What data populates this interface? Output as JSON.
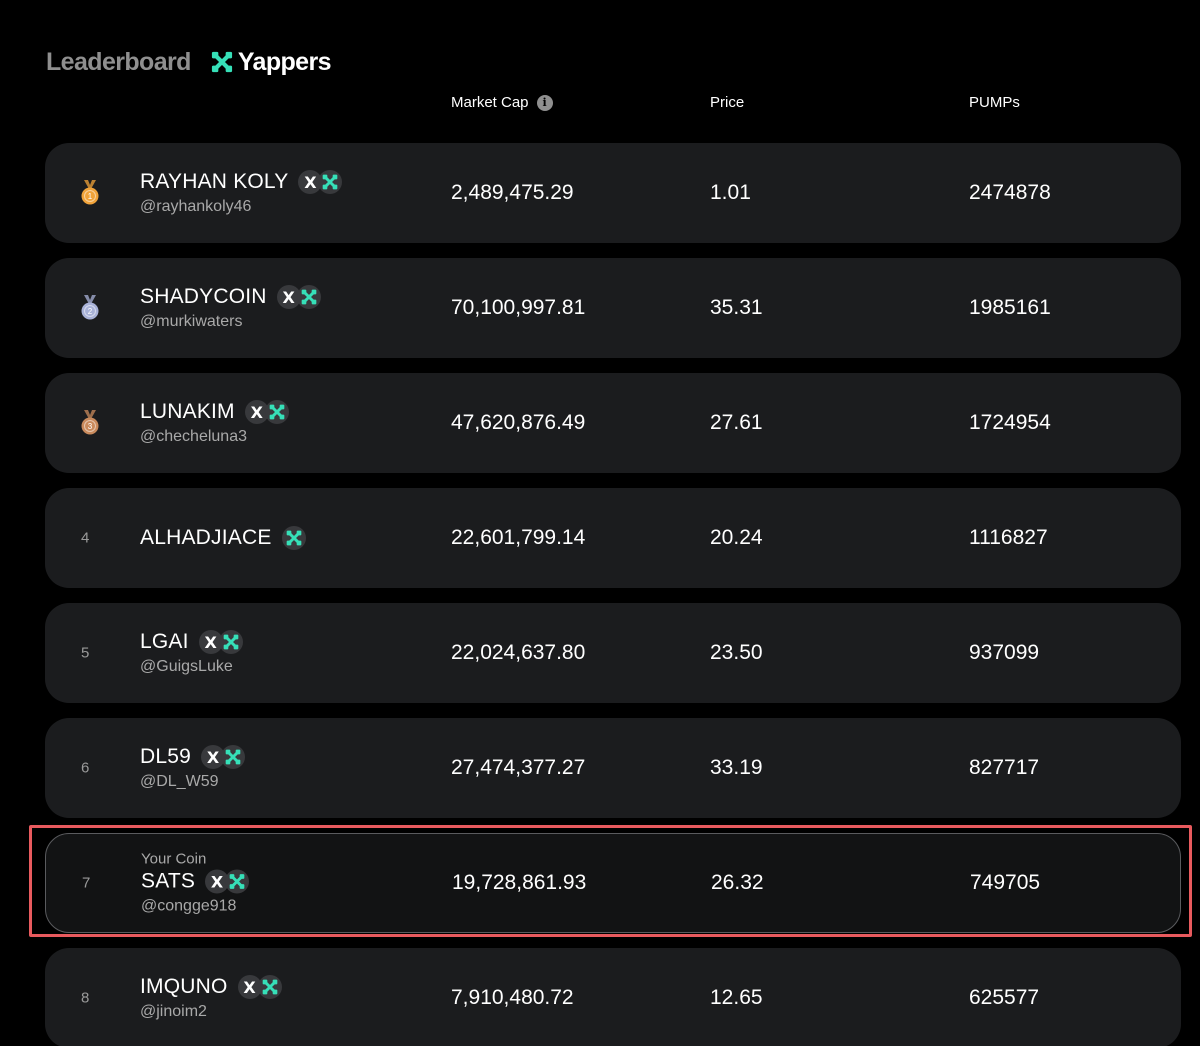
{
  "header": {
    "tab_leaderboard": "Leaderboard",
    "tab_yappers": "Yappers"
  },
  "columns": {
    "market_cap": "Market Cap",
    "price": "Price",
    "pumps": "PUMPs"
  },
  "colors": {
    "accent": "#36e0b8",
    "highlight_border": "#e85a5e",
    "row_bg": "#1b1c1e",
    "gold": "#f1a33a",
    "silver": "#a9b2d8",
    "bronze": "#c98a5c"
  },
  "rows": [
    {
      "rank": "1",
      "medal": "gold",
      "name": "RAYHAN KOLY",
      "handle": "@rayhankoly46",
      "badges": [
        "x-icon",
        "yappers-icon"
      ],
      "market_cap": "2,489,475.29",
      "price": "1.01",
      "pumps": "2474878"
    },
    {
      "rank": "2",
      "medal": "silver",
      "name": "SHADYCOIN",
      "handle": "@murkiwaters",
      "badges": [
        "x-icon",
        "yappers-icon"
      ],
      "market_cap": "70,100,997.81",
      "price": "35.31",
      "pumps": "1985161"
    },
    {
      "rank": "3",
      "medal": "bronze",
      "name": "LUNAKIM",
      "handle": "@checheluna3",
      "badges": [
        "x-icon",
        "yappers-icon"
      ],
      "market_cap": "47,620,876.49",
      "price": "27.61",
      "pumps": "1724954"
    },
    {
      "rank": "4",
      "name": "ALHADJIACE",
      "handle": "",
      "badges": [
        "yappers-icon"
      ],
      "market_cap": "22,601,799.14",
      "price": "20.24",
      "pumps": "1116827"
    },
    {
      "rank": "5",
      "name": "LGAI",
      "handle": "@GuigsLuke",
      "badges": [
        "x-icon",
        "yappers-icon"
      ],
      "market_cap": "22,024,637.80",
      "price": "23.50",
      "pumps": "937099"
    },
    {
      "rank": "6",
      "name": "DL59",
      "handle": "@DL_W59",
      "badges": [
        "x-icon",
        "yappers-icon"
      ],
      "market_cap": "27,474,377.27",
      "price": "33.19",
      "pumps": "827717"
    },
    {
      "rank": "7",
      "label": "Your Coin",
      "highlight": true,
      "name": "SATS",
      "handle": "@congge918",
      "badges": [
        "x-icon",
        "yappers-icon"
      ],
      "market_cap": "19,728,861.93",
      "price": "26.32",
      "pumps": "749705"
    },
    {
      "rank": "8",
      "name": "IMQUNO",
      "handle": "@jinoim2",
      "badges": [
        "x-icon",
        "yappers-icon"
      ],
      "market_cap": "7,910,480.72",
      "price": "12.65",
      "pumps": "625577"
    }
  ]
}
